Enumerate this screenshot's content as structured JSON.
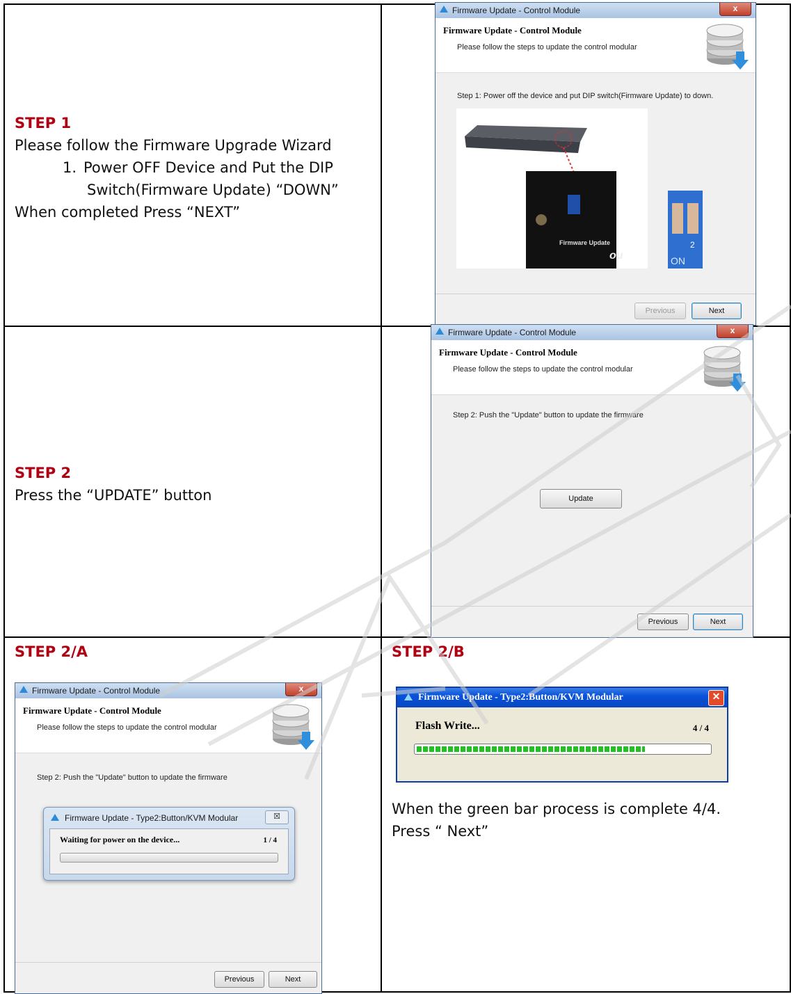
{
  "step1": {
    "title": "STEP 1",
    "line1": "Please follow the Firmware Upgrade Wizard",
    "item_num": "1.",
    "item_line1": "Power OFF Device and Put the DIP",
    "item_line2": "Switch(Firmware Update) “DOWN”",
    "line_final": "When completed Press “NEXT”"
  },
  "step2": {
    "title": "STEP 2",
    "line1": "Press the “UPDATE” button"
  },
  "step2a": {
    "title": "STEP 2/A"
  },
  "step2b": {
    "title": "STEP 2/B",
    "line1": "When the green bar process is complete 4/4.",
    "line2": "Press “ Next”"
  },
  "dialog1": {
    "window_title": "Firmware Update - Control Module",
    "header_title": "Firmware Update - Control Module",
    "header_sub": "Please follow the steps to update the control modular",
    "step_text": "Step 1: Power off the device and put DIP switch(Firmware Update) to down.",
    "photo_label": "Firmware Update",
    "photo_brand": "ou",
    "dip_on": "ON",
    "dip_2": "2",
    "previous": "Previous",
    "next": "Next",
    "close": "x"
  },
  "dialog2": {
    "window_title": "Firmware Update - Control Module",
    "header_title": "Firmware Update - Control Module",
    "header_sub": "Please follow the steps to update the control modular",
    "step_text": "Step 2: Push the \"Update\" button to update the firmware",
    "update": "Update",
    "previous": "Previous",
    "next": "Next",
    "close": "x"
  },
  "dialog3": {
    "window_title": "Firmware Update - Control Module",
    "header_title": "Firmware Update - Control Module",
    "header_sub": "Please follow the steps to update the control modular",
    "step_text": "Step 2: Push the \"Update\" button to update the firmware",
    "previous": "Previous",
    "next": "Next",
    "close": "x",
    "popup": {
      "title": "Firmware Update  - Type2:Button/KVM Modular",
      "status": "Waiting for power on the device...",
      "count": "1 / 4",
      "progress": 0,
      "close": "☒"
    }
  },
  "xp_dialog": {
    "title": "Firmware Update  - Type2:Button/KVM Modular",
    "status": "Flash Write...",
    "count": "4 / 4",
    "progress": 1.0,
    "close": "✕"
  },
  "colors": {
    "step_title": "#b00012",
    "progress_green": "#22c122"
  }
}
